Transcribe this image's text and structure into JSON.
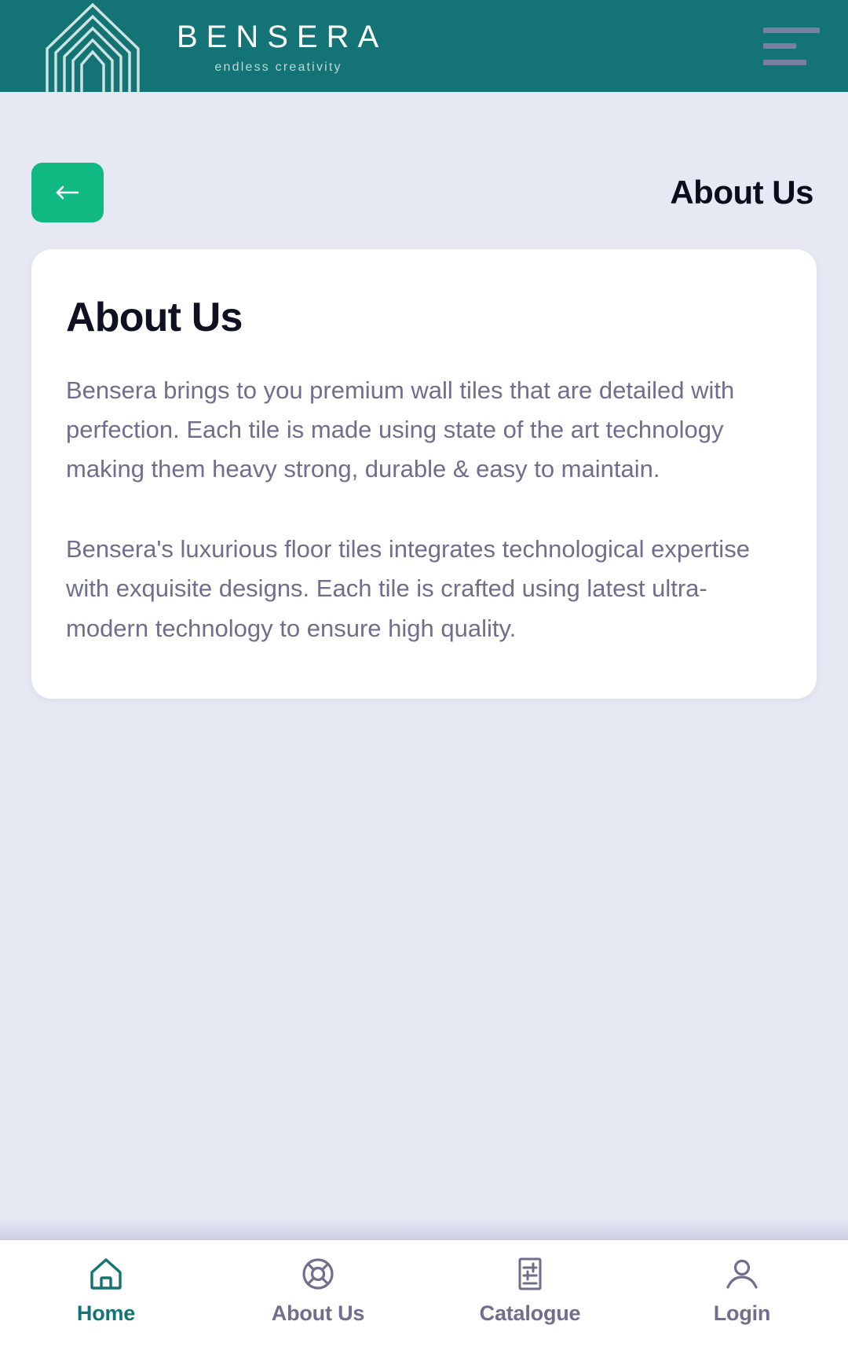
{
  "brand": {
    "logo_icon": "nested-arch-logo",
    "name": "BENSERA",
    "tagline": "endless creativity",
    "bar_color": "#137375"
  },
  "header": {
    "menu_icon": "hamburger-menu-icon",
    "back_icon": "arrow-left-icon",
    "back_label": "",
    "title": "About Us",
    "back_button_color": "#10b981"
  },
  "card": {
    "title": "About Us",
    "paragraphs": [
      "Bensera brings to you premium wall tiles that are detailed with perfection. Each tile is made using state of the art technology making them heavy strong, durable & easy to maintain.",
      "Bensera's luxurious floor tiles integrates technological expertise with exquisite designs. Each tile is crafted using latest ultra-modern technology to ensure high quality."
    ],
    "background": "#ffffff",
    "title_color": "#0f1021",
    "text_color": "#6f6e8d"
  },
  "page": {
    "background": "#e6e8f4"
  },
  "bottom_nav": {
    "active_color": "#137375",
    "inactive_color": "#6f6e8d",
    "items": [
      {
        "label": "Home",
        "icon": "home-icon",
        "active": true
      },
      {
        "label": "About Us",
        "icon": "lifebuoy-icon",
        "active": false
      },
      {
        "label": "Catalogue",
        "icon": "catalogue-sliders-icon",
        "active": false
      },
      {
        "label": "Login",
        "icon": "user-icon",
        "active": false
      }
    ]
  }
}
